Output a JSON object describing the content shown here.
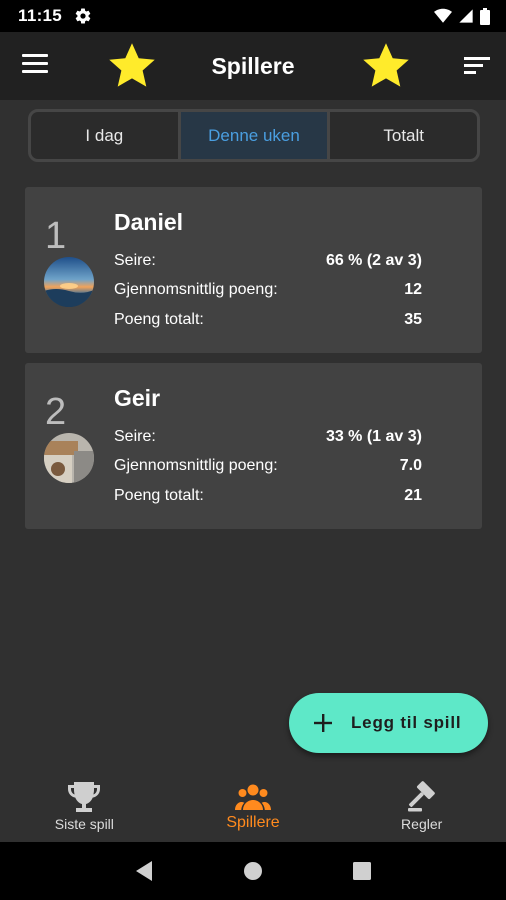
{
  "status_bar": {
    "time": "11:15"
  },
  "app_bar": {
    "title": "Spillere"
  },
  "segments": [
    {
      "label": "I dag",
      "active": false
    },
    {
      "label": "Denne uken",
      "active": true
    },
    {
      "label": "Totalt",
      "active": false
    }
  ],
  "players": [
    {
      "rank": "1",
      "name": "Daniel",
      "stats": [
        {
          "label": "Seire:",
          "value": "66 % (2 av 3)"
        },
        {
          "label": "Gjennomsnittlig poeng:",
          "value": "12"
        },
        {
          "label": "Poeng totalt:",
          "value": "35"
        }
      ]
    },
    {
      "rank": "2",
      "name": "Geir",
      "stats": [
        {
          "label": "Seire:",
          "value": "33 % (1 av 3)"
        },
        {
          "label": "Gjennomsnittlig poeng:",
          "value": "7.0"
        },
        {
          "label": "Poeng totalt:",
          "value": "21"
        }
      ]
    }
  ],
  "fab": {
    "label": "Legg til spill",
    "icon": "plus-icon"
  },
  "bottom_nav": [
    {
      "label": "Siste spill",
      "icon": "trophy-icon",
      "active": false
    },
    {
      "label": "Spillere",
      "icon": "people-icon",
      "active": true
    },
    {
      "label": "Regler",
      "icon": "gavel-icon",
      "active": false
    }
  ],
  "colors": {
    "accent_active_tab": "#4a9ee0",
    "accent_nav": "#ff8a1e",
    "fab": "#5ee8c8",
    "star": "#ffeb2b",
    "card": "#424242"
  }
}
